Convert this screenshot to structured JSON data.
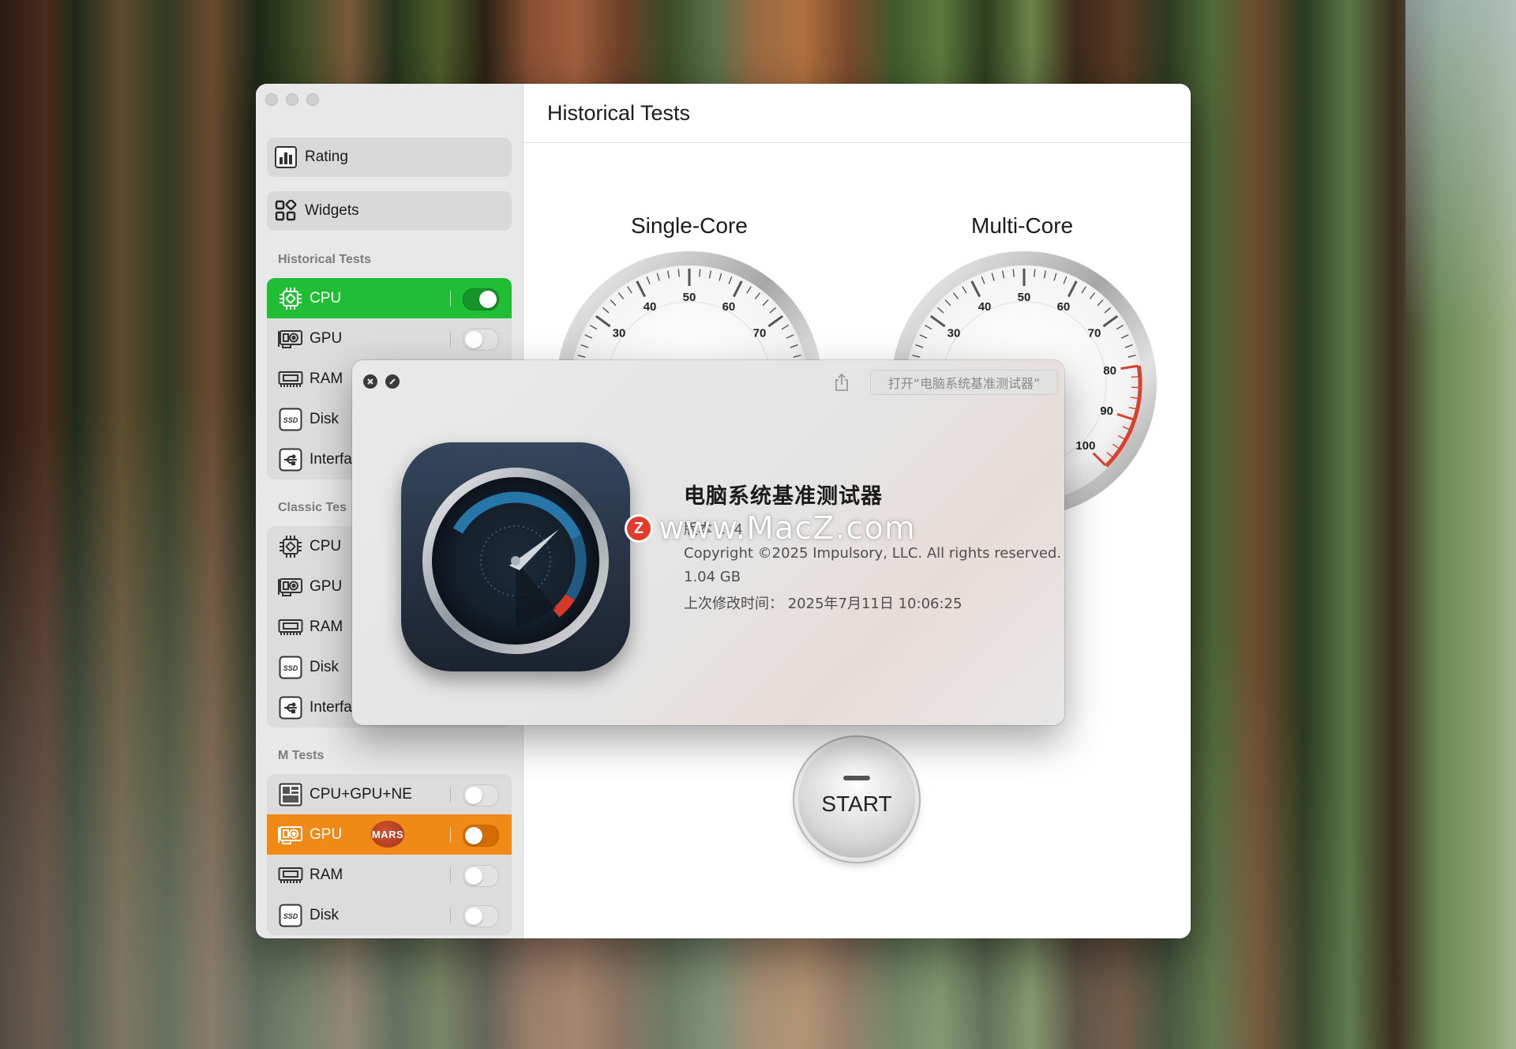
{
  "window": {
    "title": "Historical Tests"
  },
  "sidebar": {
    "top_buttons": [
      {
        "label": "Rating",
        "icon": "bar-chart-icon"
      },
      {
        "label": "Widgets",
        "icon": "widgets-grid-icon"
      }
    ],
    "sections": [
      {
        "title": "Historical Tests",
        "items": [
          {
            "label": "CPU",
            "icon": "cpu-chip-icon",
            "toggle": true,
            "on": true,
            "selected": true
          },
          {
            "label": "GPU",
            "icon": "gpu-card-icon",
            "toggle": true,
            "on": false
          },
          {
            "label": "RAM",
            "icon": "ram-module-icon"
          },
          {
            "label": "Disk",
            "icon": "ssd-icon",
            "icon_text": "SSD"
          },
          {
            "label": "Interfa",
            "icon": "usb-interface-icon"
          }
        ]
      },
      {
        "title": "Classic Tes",
        "items": [
          {
            "label": "CPU",
            "icon": "cpu-chip-icon"
          },
          {
            "label": "GPU",
            "icon": "gpu-card-icon"
          },
          {
            "label": "RAM",
            "icon": "ram-module-icon"
          },
          {
            "label": "Disk",
            "icon": "ssd-icon",
            "icon_text": "SSD"
          },
          {
            "label": "Interfa",
            "icon": "usb-interface-icon"
          }
        ]
      },
      {
        "title": "M Tests",
        "items": [
          {
            "label": "CPU+GPU+NE",
            "icon": "soc-icon",
            "toggle": true,
            "on": false
          },
          {
            "label": "GPU",
            "icon": "gpu-card-icon",
            "toggle": true,
            "on": false,
            "badge": "MARS",
            "highlighted": true
          },
          {
            "label": "RAM",
            "icon": "ram-module-icon",
            "toggle": true,
            "on": false
          },
          {
            "label": "Disk",
            "icon": "ssd-icon",
            "icon_text": "SSD",
            "toggle": true,
            "on": false
          }
        ]
      }
    ]
  },
  "gauges": {
    "single": {
      "label": "Single-Core",
      "ticks": [
        "30",
        "40",
        "50",
        "60",
        "70"
      ]
    },
    "multi": {
      "label": "Multi-Core",
      "ticks": [
        "30",
        "40",
        "50",
        "60",
        "70",
        "80",
        "90",
        "100"
      ]
    }
  },
  "start_button": {
    "label": "START"
  },
  "about_dialog": {
    "open_button": "打开“电脑系统基准测试器”",
    "app_name": "电脑系统基准测试器",
    "version": "版本 ….4",
    "copyright": "Copyright ©2025 Impulsory, LLC. All rights reserved.",
    "size": "1.04 GB",
    "modified": "上次修改时间：  2025年7月11日 10:06:25"
  },
  "watermark": {
    "logo_letter": "Z",
    "text": "www.MacZ.com"
  },
  "colors": {
    "selected_green": "#1fbe35",
    "mars_orange": "#f08a17",
    "gauge_red_zone": "#e0452f",
    "icon_background": "#2a3547"
  }
}
